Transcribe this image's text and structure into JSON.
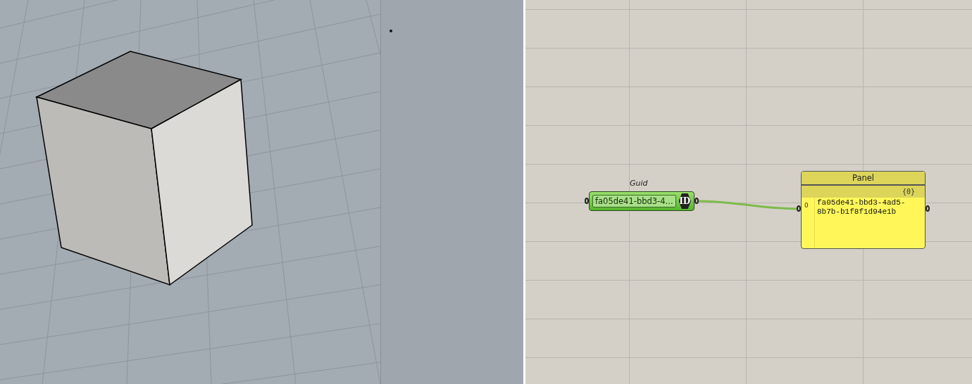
{
  "guid_param": {
    "title": "Guid",
    "value": "fa05de41-bbd3-4...",
    "badge": "ID"
  },
  "panel": {
    "title": "Panel",
    "path": "{0}",
    "index": "0",
    "text": "fa05de41-bbd3-4ad5-8b7b-b1f8f1d94e1b"
  }
}
